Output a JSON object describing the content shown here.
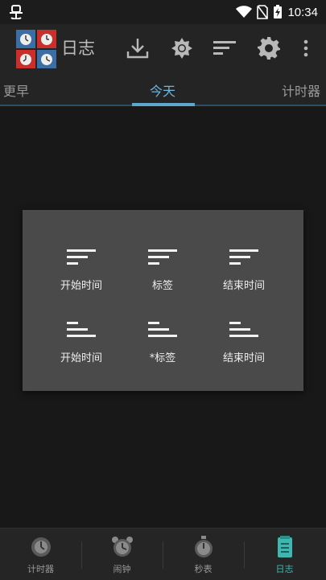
{
  "status_bar": {
    "time": "10:34",
    "app_icon": "bug-icon"
  },
  "app_bar": {
    "title": "日志",
    "actions": [
      "download-icon",
      "brightness-icon",
      "sort-icon",
      "settings-icon",
      "overflow-menu-icon"
    ]
  },
  "tabs": [
    {
      "label": "更早",
      "active": false
    },
    {
      "label": "今天",
      "active": true
    },
    {
      "label": "计时器",
      "active": false
    }
  ],
  "sort_dialog": {
    "descending": [
      {
        "label": "开始时间",
        "icon": "sort-descending-icon"
      },
      {
        "label": "标签",
        "icon": "sort-descending-icon"
      },
      {
        "label": "结束时间",
        "icon": "sort-descending-icon"
      }
    ],
    "ascending": [
      {
        "label": "开始时间",
        "icon": "sort-ascending-icon"
      },
      {
        "label": "*标签",
        "icon": "sort-ascending-icon"
      },
      {
        "label": "结束时间",
        "icon": "sort-ascending-icon"
      }
    ]
  },
  "bottom_nav": [
    {
      "label": "计时器",
      "icon": "timer-icon",
      "active": false
    },
    {
      "label": "闹钟",
      "icon": "alarm-clock-icon",
      "active": false
    },
    {
      "label": "秒表",
      "icon": "stopwatch-icon",
      "active": false
    },
    {
      "label": "日志",
      "icon": "log-icon",
      "active": true
    }
  ],
  "colors": {
    "accent": "#5da7cf",
    "active_nav": "#3fb6b0",
    "dialog": "#4a4a4a"
  }
}
